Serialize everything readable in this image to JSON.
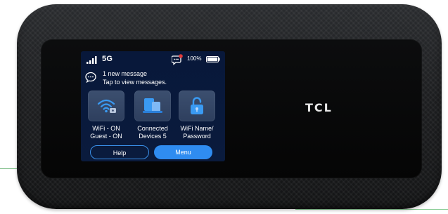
{
  "status_bar": {
    "network": "5G",
    "battery_percent": "100%",
    "signal_level": 4,
    "battery_level": 1.0,
    "has_unread_badge": true
  },
  "notification": {
    "title": "1 new message",
    "subtitle": "Tap to view messages."
  },
  "tiles": [
    {
      "icon": "wifi-router-icon",
      "label_line1": "WiFi - ON",
      "label_line2": "Guest - ON"
    },
    {
      "icon": "connected-devices-icon",
      "label_line1": "Connected",
      "label_line2": "Devices 5"
    },
    {
      "icon": "lock-unlocked-icon",
      "label_line1": "WiFi Name/",
      "label_line2": "Password"
    }
  ],
  "buttons": {
    "help": "Help",
    "menu": "Menu"
  },
  "brand": {
    "logo": "TCL"
  },
  "colors": {
    "screen_bg": "#0a1b3d",
    "tile_bg": "#34476a",
    "accent_blue": "#2f8cf0",
    "device_body": "#1d1e20",
    "badge_red": "#e23b3b"
  }
}
